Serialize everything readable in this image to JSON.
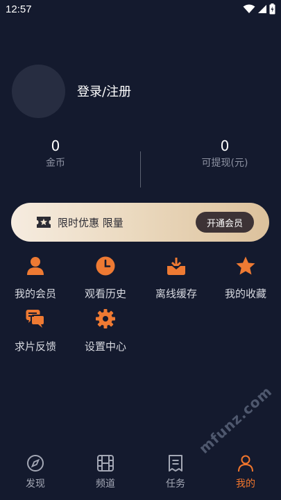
{
  "status_bar": {
    "time": "12:57",
    "icons": [
      "wifi-icon",
      "signal-icon",
      "battery-icon"
    ]
  },
  "profile": {
    "login_label": "登录/注册"
  },
  "stats": [
    {
      "value": "0",
      "label": "金币"
    },
    {
      "value": "0",
      "label": "可提现(元)"
    }
  ],
  "vip_banner": {
    "text": "限时优惠 限量",
    "button_label": "开通会员",
    "icon": "ticket-star-icon"
  },
  "menu": [
    {
      "label": "我的会员",
      "icon": "person-icon"
    },
    {
      "label": "观看历史",
      "icon": "clock-icon"
    },
    {
      "label": "离线缓存",
      "icon": "download-icon"
    },
    {
      "label": "我的收藏",
      "icon": "star-icon"
    },
    {
      "label": "求片反馈",
      "icon": "chat-icon"
    },
    {
      "label": "设置中心",
      "icon": "gear-icon"
    }
  ],
  "bottom_nav": [
    {
      "label": "发现",
      "icon": "compass-icon",
      "active": false
    },
    {
      "label": "频道",
      "icon": "film-icon",
      "active": false
    },
    {
      "label": "任务",
      "icon": "task-list-icon",
      "active": false
    },
    {
      "label": "我的",
      "icon": "person-outline-icon",
      "active": true
    }
  ],
  "watermark": "mfunz.com",
  "colors": {
    "background": "#141a2e",
    "accent": "#f2762c",
    "banner_start": "#f6ece0",
    "banner_end": "#dcc19c"
  }
}
